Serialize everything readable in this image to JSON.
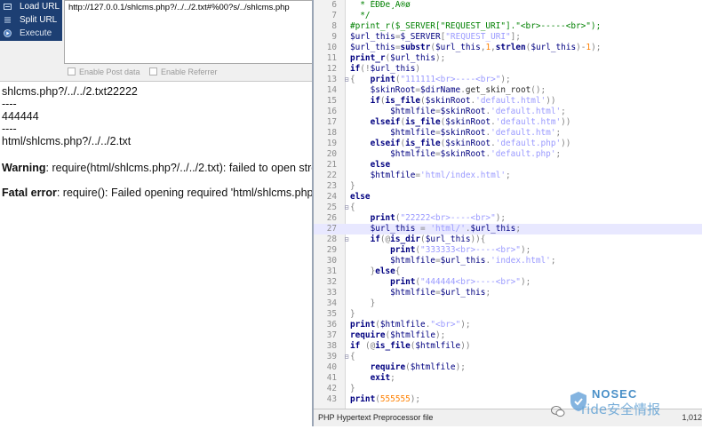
{
  "hackbar": {
    "menu": [
      {
        "label": "Load URL",
        "icon": "load-url-icon"
      },
      {
        "label": "Split URL",
        "icon": "split-url-icon"
      },
      {
        "label": "Execute",
        "icon": "execute-icon"
      }
    ],
    "url_value": "http://127.0.0.1/shlcms.php?/../../2.txt#%00?s/../shlcms.php",
    "options": [
      {
        "label": "Enable Post data",
        "checked": false
      },
      {
        "label": "Enable Referrer",
        "checked": false
      }
    ]
  },
  "output": {
    "line1": "shlcms.php?/../../2.txt22222",
    "line2": "----",
    "line3": "444444",
    "line4": "----",
    "line5": "html/shlcms.php?/../../2.txt",
    "warning_label": "Warning",
    "warning_text": ": require(html/shlcms.php?/../../2.txt): failed to open stre",
    "fatal_label": "Fatal error",
    "fatal_text": ": require(): Failed opening required 'html/shlcms.php?/"
  },
  "editor": {
    "highlighted_line": 27,
    "lines": [
      {
        "n": "6",
        "fold": "",
        "tokens": [
          {
            "c": "cmt",
            "t": "  * ÈÐÐe¸A®ø"
          }
        ]
      },
      {
        "n": "7",
        "fold": "",
        "tokens": [
          {
            "c": "cmt",
            "t": "  */"
          }
        ]
      },
      {
        "n": "8",
        "fold": "",
        "tokens": [
          {
            "c": "cmt",
            "t": "#print_r($_SERVER[\"REQUEST_URI\"].\"<br>-----<br>\");"
          }
        ]
      },
      {
        "n": "9",
        "fold": "",
        "tokens": [
          {
            "c": "var",
            "t": "$url_this"
          },
          {
            "c": "op",
            "t": "="
          },
          {
            "c": "var",
            "t": "$_SERVER"
          },
          {
            "c": "op",
            "t": "["
          },
          {
            "c": "str",
            "t": "\"REQUEST_URI\""
          },
          {
            "c": "op",
            "t": "];"
          }
        ]
      },
      {
        "n": "10",
        "fold": "",
        "tokens": [
          {
            "c": "var",
            "t": "$url_this"
          },
          {
            "c": "op",
            "t": "="
          },
          {
            "c": "kw",
            "t": "substr"
          },
          {
            "c": "op",
            "t": "("
          },
          {
            "c": "var",
            "t": "$url_this"
          },
          {
            "c": "op",
            "t": ","
          },
          {
            "c": "num",
            "t": "1"
          },
          {
            "c": "op",
            "t": ","
          },
          {
            "c": "kw",
            "t": "strlen"
          },
          {
            "c": "op",
            "t": "("
          },
          {
            "c": "var",
            "t": "$url_this"
          },
          {
            "c": "op",
            "t": ")-"
          },
          {
            "c": "num",
            "t": "1"
          },
          {
            "c": "op",
            "t": ");"
          }
        ]
      },
      {
        "n": "11",
        "fold": "",
        "tokens": [
          {
            "c": "kw",
            "t": "print_r"
          },
          {
            "c": "op",
            "t": "("
          },
          {
            "c": "var",
            "t": "$url_this"
          },
          {
            "c": "op",
            "t": ");"
          }
        ]
      },
      {
        "n": "12",
        "fold": "",
        "tokens": [
          {
            "c": "kw",
            "t": "if"
          },
          {
            "c": "op",
            "t": "(!"
          },
          {
            "c": "var",
            "t": "$url_this"
          },
          {
            "c": "op",
            "t": ")"
          }
        ]
      },
      {
        "n": "13",
        "fold": "⊟",
        "tokens": [
          {
            "c": "op",
            "t": "{"
          },
          {
            "c": "plain",
            "t": "   "
          },
          {
            "c": "kw",
            "t": "print"
          },
          {
            "c": "op",
            "t": "("
          },
          {
            "c": "str",
            "t": "\"111111<br>----<br>\""
          },
          {
            "c": "op",
            "t": ");"
          }
        ]
      },
      {
        "n": "14",
        "fold": "",
        "tokens": [
          {
            "c": "plain",
            "t": "    "
          },
          {
            "c": "var",
            "t": "$skinRoot"
          },
          {
            "c": "op",
            "t": "="
          },
          {
            "c": "var",
            "t": "$dirName"
          },
          {
            "c": "op",
            "t": "."
          },
          {
            "c": "plain",
            "t": "get_skin_root"
          },
          {
            "c": "op",
            "t": "();"
          }
        ]
      },
      {
        "n": "15",
        "fold": "",
        "tokens": [
          {
            "c": "plain",
            "t": "    "
          },
          {
            "c": "kw",
            "t": "if"
          },
          {
            "c": "op",
            "t": "("
          },
          {
            "c": "kw",
            "t": "is_file"
          },
          {
            "c": "op",
            "t": "("
          },
          {
            "c": "var",
            "t": "$skinRoot"
          },
          {
            "c": "op",
            "t": "."
          },
          {
            "c": "str",
            "t": "'default.html'"
          },
          {
            "c": "op",
            "t": "))"
          }
        ]
      },
      {
        "n": "16",
        "fold": "",
        "tokens": [
          {
            "c": "plain",
            "t": "        "
          },
          {
            "c": "var",
            "t": "$htmlfile"
          },
          {
            "c": "op",
            "t": "="
          },
          {
            "c": "var",
            "t": "$skinRoot"
          },
          {
            "c": "op",
            "t": "."
          },
          {
            "c": "str",
            "t": "'default.html'"
          },
          {
            "c": "op",
            "t": ";"
          }
        ]
      },
      {
        "n": "17",
        "fold": "",
        "tokens": [
          {
            "c": "plain",
            "t": "    "
          },
          {
            "c": "kw",
            "t": "elseif"
          },
          {
            "c": "op",
            "t": "("
          },
          {
            "c": "kw",
            "t": "is_file"
          },
          {
            "c": "op",
            "t": "("
          },
          {
            "c": "var",
            "t": "$skinRoot"
          },
          {
            "c": "op",
            "t": "."
          },
          {
            "c": "str",
            "t": "'default.htm'"
          },
          {
            "c": "op",
            "t": "))"
          }
        ]
      },
      {
        "n": "18",
        "fold": "",
        "tokens": [
          {
            "c": "plain",
            "t": "        "
          },
          {
            "c": "var",
            "t": "$htmlfile"
          },
          {
            "c": "op",
            "t": "="
          },
          {
            "c": "var",
            "t": "$skinRoot"
          },
          {
            "c": "op",
            "t": "."
          },
          {
            "c": "str",
            "t": "'default.htm'"
          },
          {
            "c": "op",
            "t": ";"
          }
        ]
      },
      {
        "n": "19",
        "fold": "",
        "tokens": [
          {
            "c": "plain",
            "t": "    "
          },
          {
            "c": "kw",
            "t": "elseif"
          },
          {
            "c": "op",
            "t": "("
          },
          {
            "c": "kw",
            "t": "is_file"
          },
          {
            "c": "op",
            "t": "("
          },
          {
            "c": "var",
            "t": "$skinRoot"
          },
          {
            "c": "op",
            "t": "."
          },
          {
            "c": "str",
            "t": "'default.php'"
          },
          {
            "c": "op",
            "t": "))"
          }
        ]
      },
      {
        "n": "20",
        "fold": "",
        "tokens": [
          {
            "c": "plain",
            "t": "        "
          },
          {
            "c": "var",
            "t": "$htmlfile"
          },
          {
            "c": "op",
            "t": "="
          },
          {
            "c": "var",
            "t": "$skinRoot"
          },
          {
            "c": "op",
            "t": "."
          },
          {
            "c": "str",
            "t": "'default.php'"
          },
          {
            "c": "op",
            "t": ";"
          }
        ]
      },
      {
        "n": "21",
        "fold": "",
        "tokens": [
          {
            "c": "plain",
            "t": "    "
          },
          {
            "c": "kw",
            "t": "else"
          }
        ]
      },
      {
        "n": "22",
        "fold": "",
        "tokens": [
          {
            "c": "plain",
            "t": "    "
          },
          {
            "c": "var",
            "t": "$htmlfile"
          },
          {
            "c": "op",
            "t": "="
          },
          {
            "c": "str",
            "t": "'html/index.html'"
          },
          {
            "c": "op",
            "t": ";"
          }
        ]
      },
      {
        "n": "23",
        "fold": "",
        "tokens": [
          {
            "c": "op",
            "t": "}"
          }
        ]
      },
      {
        "n": "24",
        "fold": "",
        "tokens": [
          {
            "c": "kw",
            "t": "else"
          }
        ]
      },
      {
        "n": "25",
        "fold": "⊟",
        "tokens": [
          {
            "c": "op",
            "t": "{"
          }
        ]
      },
      {
        "n": "26",
        "fold": "",
        "tokens": [
          {
            "c": "plain",
            "t": "    "
          },
          {
            "c": "kw",
            "t": "print"
          },
          {
            "c": "op",
            "t": "("
          },
          {
            "c": "str",
            "t": "\"22222<br>----<br>\""
          },
          {
            "c": "op",
            "t": ");"
          }
        ]
      },
      {
        "n": "27",
        "fold": "",
        "tokens": [
          {
            "c": "plain",
            "t": "    "
          },
          {
            "c": "var",
            "t": "$url_this"
          },
          {
            "c": "op",
            "t": " = "
          },
          {
            "c": "str",
            "t": "'html/'"
          },
          {
            "c": "op",
            "t": "."
          },
          {
            "c": "var",
            "t": "$url_this"
          },
          {
            "c": "op",
            "t": ";"
          }
        ]
      },
      {
        "n": "28",
        "fold": "⊟",
        "tokens": [
          {
            "c": "plain",
            "t": "    "
          },
          {
            "c": "kw",
            "t": "if"
          },
          {
            "c": "op",
            "t": "(@"
          },
          {
            "c": "kw",
            "t": "is_dir"
          },
          {
            "c": "op",
            "t": "("
          },
          {
            "c": "var",
            "t": "$url_this"
          },
          {
            "c": "op",
            "t": ")){"
          }
        ]
      },
      {
        "n": "29",
        "fold": "",
        "tokens": [
          {
            "c": "plain",
            "t": "        "
          },
          {
            "c": "kw",
            "t": "print"
          },
          {
            "c": "op",
            "t": "("
          },
          {
            "c": "str",
            "t": "\"333333<br>----<br>\""
          },
          {
            "c": "op",
            "t": ");"
          }
        ]
      },
      {
        "n": "30",
        "fold": "",
        "tokens": [
          {
            "c": "plain",
            "t": "        "
          },
          {
            "c": "var",
            "t": "$htmlfile"
          },
          {
            "c": "op",
            "t": "="
          },
          {
            "c": "var",
            "t": "$url_this"
          },
          {
            "c": "op",
            "t": "."
          },
          {
            "c": "str",
            "t": "'index.html'"
          },
          {
            "c": "op",
            "t": ";"
          }
        ]
      },
      {
        "n": "31",
        "fold": "",
        "tokens": [
          {
            "c": "plain",
            "t": "    "
          },
          {
            "c": "op",
            "t": "}"
          },
          {
            "c": "kw",
            "t": "else"
          },
          {
            "c": "op",
            "t": "{"
          }
        ]
      },
      {
        "n": "32",
        "fold": "",
        "tokens": [
          {
            "c": "plain",
            "t": "        "
          },
          {
            "c": "kw",
            "t": "print"
          },
          {
            "c": "op",
            "t": "("
          },
          {
            "c": "str",
            "t": "\"444444<br>----<br>\""
          },
          {
            "c": "op",
            "t": ");"
          }
        ]
      },
      {
        "n": "33",
        "fold": "",
        "tokens": [
          {
            "c": "plain",
            "t": "        "
          },
          {
            "c": "var",
            "t": "$htmlfile"
          },
          {
            "c": "op",
            "t": "="
          },
          {
            "c": "var",
            "t": "$url_this"
          },
          {
            "c": "op",
            "t": ";"
          }
        ]
      },
      {
        "n": "34",
        "fold": "",
        "tokens": [
          {
            "c": "plain",
            "t": "    "
          },
          {
            "c": "op",
            "t": "}"
          }
        ]
      },
      {
        "n": "35",
        "fold": "",
        "tokens": [
          {
            "c": "op",
            "t": "}"
          }
        ]
      },
      {
        "n": "36",
        "fold": "",
        "tokens": [
          {
            "c": "kw",
            "t": "print"
          },
          {
            "c": "op",
            "t": "("
          },
          {
            "c": "var",
            "t": "$htmlfile"
          },
          {
            "c": "op",
            "t": "."
          },
          {
            "c": "str",
            "t": "\"<br>\""
          },
          {
            "c": "op",
            "t": ");"
          }
        ]
      },
      {
        "n": "37",
        "fold": "",
        "tokens": [
          {
            "c": "kw",
            "t": "require"
          },
          {
            "c": "op",
            "t": "("
          },
          {
            "c": "var",
            "t": "$htmlfile"
          },
          {
            "c": "op",
            "t": ");"
          }
        ]
      },
      {
        "n": "38",
        "fold": "",
        "tokens": [
          {
            "c": "kw",
            "t": "if"
          },
          {
            "c": "op",
            "t": " (@"
          },
          {
            "c": "kw",
            "t": "is_file"
          },
          {
            "c": "op",
            "t": "("
          },
          {
            "c": "var",
            "t": "$htmlfile"
          },
          {
            "c": "op",
            "t": "))"
          }
        ]
      },
      {
        "n": "39",
        "fold": "⊟",
        "tokens": [
          {
            "c": "op",
            "t": "{"
          }
        ]
      },
      {
        "n": "40",
        "fold": "",
        "tokens": [
          {
            "c": "plain",
            "t": "    "
          },
          {
            "c": "kw",
            "t": "require"
          },
          {
            "c": "op",
            "t": "("
          },
          {
            "c": "var",
            "t": "$htmlfile"
          },
          {
            "c": "op",
            "t": ");"
          }
        ]
      },
      {
        "n": "41",
        "fold": "",
        "tokens": [
          {
            "c": "plain",
            "t": "    "
          },
          {
            "c": "kw",
            "t": "exit"
          },
          {
            "c": "op",
            "t": ";"
          }
        ]
      },
      {
        "n": "42",
        "fold": "",
        "tokens": [
          {
            "c": "op",
            "t": "}"
          }
        ]
      },
      {
        "n": "43",
        "fold": "",
        "tokens": [
          {
            "c": "kw",
            "t": "print"
          },
          {
            "c": "op",
            "t": "("
          },
          {
            "c": "num",
            "t": "555555"
          },
          {
            "c": "op",
            "t": ");"
          }
        ]
      }
    ],
    "status_text": "PHP Hypertext Preprocessor file",
    "status_pos": "1,012"
  },
  "watermark": {
    "brand": "NOSEC",
    "sub": "ride安全情报"
  },
  "colors": {
    "hackbar_menu_bg": "#1d3f73",
    "line_highlight": "#e8e8ff",
    "keyword": "#000080",
    "string": "#9a9aff",
    "number": "#ff8000",
    "comment": "#008000"
  }
}
